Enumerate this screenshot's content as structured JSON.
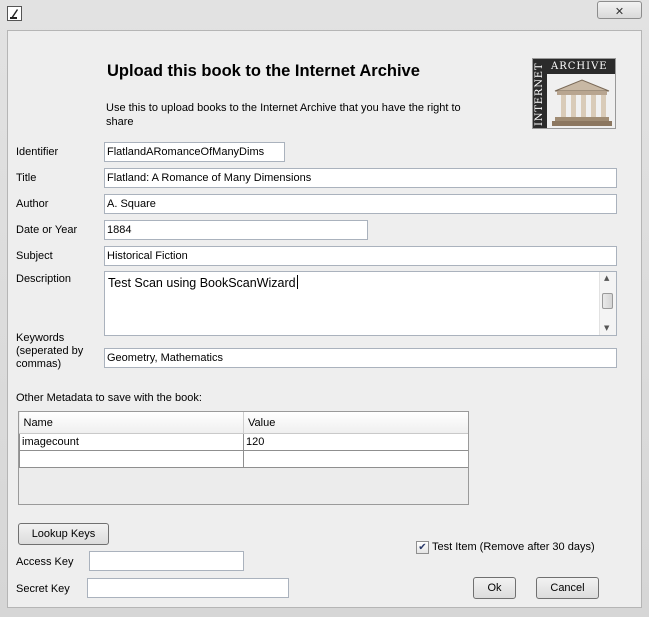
{
  "window": {
    "close_glyph": "✕"
  },
  "header": {
    "title": "Upload this book to the Internet Archive",
    "subtitle": "Use this to upload books to the Internet Archive that you have the right to share",
    "logo_text_horizontal": "ARCHIVE",
    "logo_text_vertical": "INTERNET"
  },
  "fields": {
    "identifier": {
      "label": "Identifier",
      "value": "FlatlandARomanceOfManyDims"
    },
    "title": {
      "label": "Title",
      "value": "Flatland: A Romance of Many Dimensions"
    },
    "author": {
      "label": "Author",
      "value": "A. Square"
    },
    "date": {
      "label": "Date or Year",
      "value": "1884"
    },
    "subject": {
      "label": "Subject",
      "value": "Historical Fiction"
    },
    "description": {
      "label": "Description",
      "value": "Test Scan using BookScanWizard"
    },
    "keywords": {
      "label_line1": "Keywords",
      "label_line2": "(seperated by",
      "label_line3": "commas)",
      "value": "Geometry, Mathematics"
    }
  },
  "metadata": {
    "label": "Other Metadata to save with the book:",
    "columns": [
      "Name",
      "Value"
    ],
    "rows": [
      {
        "name": "imagecount",
        "value": "120"
      },
      {
        "name": "",
        "value": ""
      }
    ]
  },
  "keys": {
    "lookup_label": "Lookup Keys",
    "access_label": "Access Key",
    "access_value": "",
    "secret_label": "Secret Key",
    "secret_value": ""
  },
  "test_item": {
    "label": "Test Item (Remove after 30 days)",
    "checked": true
  },
  "actions": {
    "ok_label": "Ok",
    "cancel_label": "Cancel"
  },
  "colors": {
    "window_bg": "#eeeeee",
    "field_border": "#aab2bd"
  }
}
